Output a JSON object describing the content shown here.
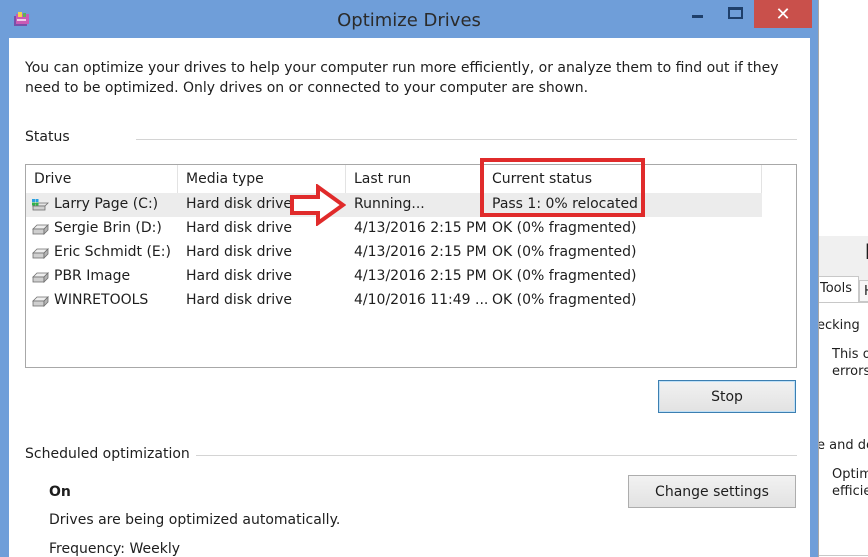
{
  "window": {
    "title": "Optimize Drives",
    "close_glyph": "✕"
  },
  "intro": {
    "line1": "You can optimize your drives to help your computer run more efficiently, or analyze them to find out if they",
    "line2": "need to be optimized. Only drives on or connected to your computer are shown."
  },
  "status": {
    "label": "Status",
    "columns": [
      "Drive",
      "Media type",
      "Last run",
      "Current status"
    ],
    "drives": [
      {
        "drive": "Larry Page (C:)",
        "media": "Hard disk drive",
        "last_run": "Running...",
        "status": "Pass 1: 0% relocated",
        "icon": "system-drive-icon",
        "selected": true
      },
      {
        "drive": "Sergie Brin (D:)",
        "media": "Hard disk drive",
        "last_run": "4/13/2016 2:15 PM",
        "status": "OK (0% fragmented)",
        "icon": "drive-icon",
        "selected": false
      },
      {
        "drive": "Eric Schmidt (E:)",
        "media": "Hard disk drive",
        "last_run": "4/13/2016 2:15 PM",
        "status": "OK (0% fragmented)",
        "icon": "drive-icon",
        "selected": false
      },
      {
        "drive": "PBR Image",
        "media": "Hard disk drive",
        "last_run": "4/13/2016 2:15 PM",
        "status": "OK (0% fragmented)",
        "icon": "drive-icon",
        "selected": false
      },
      {
        "drive": "WINRETOOLS",
        "media": "Hard disk drive",
        "last_run": "4/10/2016 11:49 ...",
        "status": "OK (0% fragmented)",
        "icon": "drive-icon",
        "selected": false
      }
    ],
    "stop_button": "Stop"
  },
  "scheduled": {
    "label": "Scheduled optimization",
    "state": "On",
    "description": "Drives are being optimized automatically.",
    "frequency": "Frequency: Weekly",
    "change_button": "Change settings"
  },
  "background_window": {
    "tab_tools": "Tools",
    "tab_h": "H",
    "checking": "ecking",
    "this_line": "This o",
    "errors_line": "errors.",
    "and_de": "e and de",
    "optim": "Optimi",
    "effici": "efficien"
  },
  "colors": {
    "titlebar": "#6f9ed9",
    "close": "#c9504b",
    "annotation": "#e02b2b",
    "selected_row": "#ececec"
  }
}
